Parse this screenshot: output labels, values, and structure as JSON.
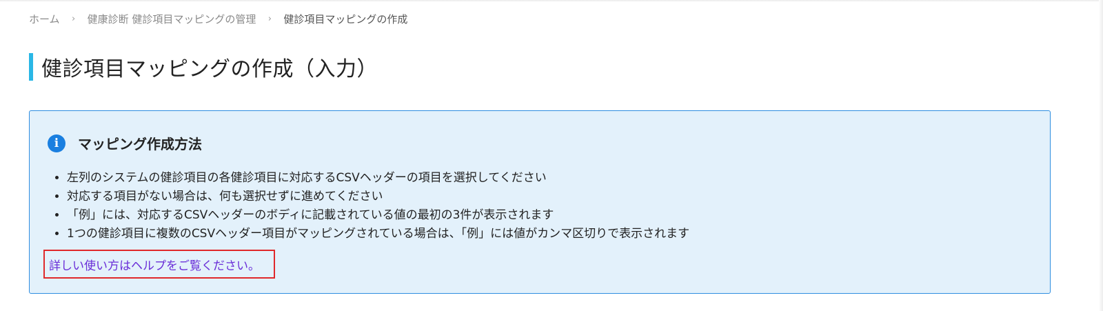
{
  "breadcrumb": {
    "items": [
      {
        "label": "ホーム"
      },
      {
        "label": "健康診断 健診項目マッピングの管理"
      },
      {
        "label": "健診項目マッピングの作成"
      }
    ],
    "separator": "›"
  },
  "page": {
    "title": "健診項目マッピングの作成（入力）",
    "accent_color": "#2ab7e6"
  },
  "info": {
    "icon": "info-icon",
    "icon_glyph": "i",
    "title": "マッピング作成方法",
    "bullets": [
      "左列のシステムの健診項目の各健診項目に対応するCSVヘッダーの項目を選択してください",
      "対応する項目がない場合は、何も選択せずに進めてください",
      "「例」には、対応するCSVヘッダーのボディに記載されている値の最初の3件が表示されます",
      "1つの健診項目に複数のCSVヘッダー項目がマッピングされている場合は、「例」には値がカンマ区切りで表示されます"
    ],
    "help_link": "詳しい使い方はヘルプをご覧ください。",
    "border_color": "#2d8de0",
    "background_color": "#e3f1fb",
    "highlight_color": "#e0282a",
    "link_color": "#6a2ed8"
  }
}
